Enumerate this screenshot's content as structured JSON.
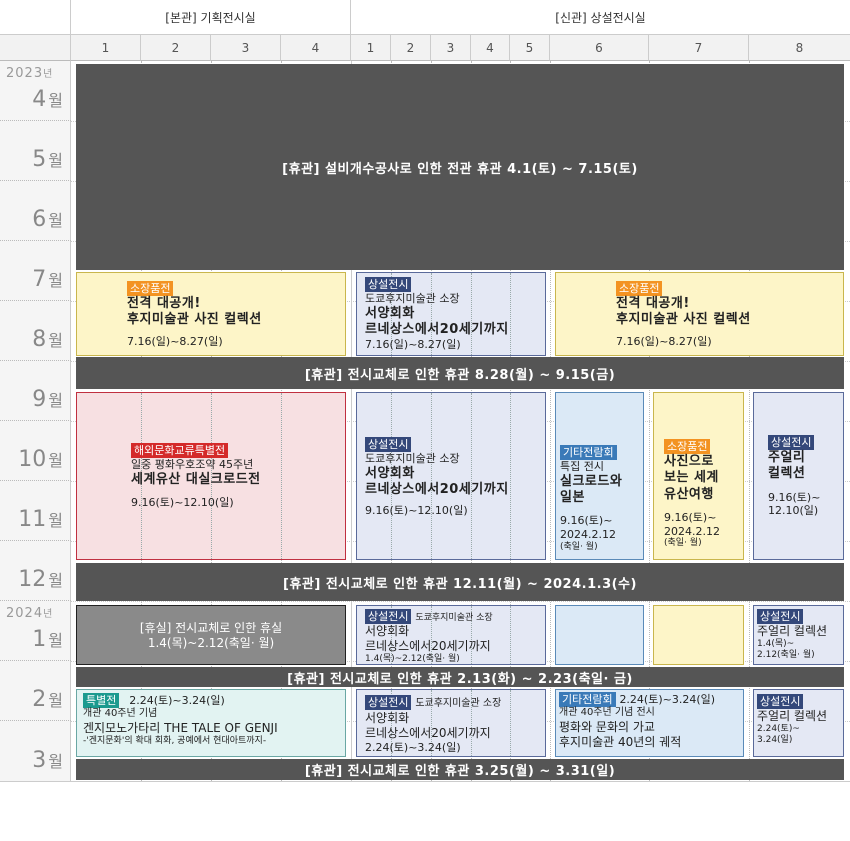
{
  "header": {
    "main_hall": "[본관] 기획전시실",
    "new_hall": "[신관] 상설전시실",
    "cols": [
      "1",
      "2",
      "3",
      "4",
      "1",
      "2",
      "3",
      "4",
      "5",
      "6",
      "7",
      "8"
    ]
  },
  "months": [
    {
      "num": "4",
      "unit": "월",
      "year": "2023",
      "year_unit": "년"
    },
    {
      "num": "5",
      "unit": "월"
    },
    {
      "num": "6",
      "unit": "월"
    },
    {
      "num": "7",
      "unit": "월"
    },
    {
      "num": "8",
      "unit": "월"
    },
    {
      "num": "9",
      "unit": "월"
    },
    {
      "num": "10",
      "unit": "월"
    },
    {
      "num": "11",
      "unit": "월"
    },
    {
      "num": "12",
      "unit": "월"
    },
    {
      "num": "1",
      "unit": "월",
      "year": "2024",
      "year_unit": "년"
    },
    {
      "num": "2",
      "unit": "월"
    },
    {
      "num": "3",
      "unit": "월"
    }
  ],
  "closures": {
    "c1": "[휴관] 설비개수공사로 인한 전관 휴관 4.1(토) ~ 7.15(토)",
    "c2": "[휴관] 전시교체로 인한 휴관 8.28(월) ~ 9.15(금)",
    "c3": "[휴관] 전시교체로 인한 휴관 12.11(월) ~ 2024.1.3(수)",
    "c4": "[휴관] 전시교체로 인한 휴관 2.13(화) ~ 2.23(축일· 금)",
    "c5": "[휴관] 전시교체로 인한 휴관 3.25(월) ~ 3.31(일)"
  },
  "ex": {
    "a1": {
      "tag": "소장품전",
      "title1": "전격 대공개!",
      "title2": "후지미술관 사진 컬렉션",
      "date": "7.16(일)~8.27(일)"
    },
    "a2": {
      "tag": "상설전시",
      "sub": "도쿄후지미술관 소장",
      "title1": "서양회화",
      "title2": "르네상스에서20세기까지",
      "date": "7.16(일)~8.27(일)"
    },
    "a3": {
      "tag": "소장품전",
      "title1": "전격 대공개!",
      "title2": "후지미술관 사진 컬렉션",
      "date": "7.16(일)~8.27(일)"
    },
    "b1": {
      "tag": "해외문화교류특별전",
      "sub": "일중 평화우호조약 45주년",
      "title": "세계유산 대실크로드전",
      "date": "9.16(토)~12.10(일)"
    },
    "b2": {
      "tag": "상설전시",
      "sub": "도쿄후지미술관 소장",
      "title1": "서양회화",
      "title2": "르네상스에서20세기까지",
      "date": "9.16(토)~12.10(일)"
    },
    "b3": {
      "tag": "기타전람회",
      "sub": "특집 전시",
      "title1": "실크로드와",
      "title2": "일본",
      "date1": "9.16(토)~",
      "date2": "2024.2.12",
      "date3": "(축일· 월)"
    },
    "b4": {
      "tag": "소장품전",
      "title1": "사진으로",
      "title2": "보는 세계",
      "title3": "유산여행",
      "date1": "9.16(토)~",
      "date2": "2024.2.12",
      "date3": "(축일· 월)"
    },
    "b5": {
      "tag": "상설전시",
      "title1": "주얼리",
      "title2": "컬렉션",
      "date1": "9.16(토)~",
      "date2": "12.10(일)"
    },
    "c_1": {
      "line1": "[휴실] 전시교체로 인한 휴실",
      "line2": "1.4(목)~2.12(축일· 월)"
    },
    "c_2": {
      "tag": "상설전시",
      "sub": "도쿄후지미술관 소장",
      "title1": "서양회화",
      "title2": "르네상스에서20세기까지",
      "date": "1.4(목)~2.12(축일· 월)"
    },
    "c_5": {
      "tag": "상설전시",
      "title": "주얼리 컬렉션",
      "date1": "1.4(목)~",
      "date2": "2.12(축일· 월)"
    },
    "d1": {
      "tag": "특별전",
      "date": "2.24(토)~3.24(일)",
      "sub": "개관 40주년 기념",
      "title": "겐지모노가타리  THE TALE OF GENJI",
      "desc": "-'겐지문화'의 확대 회화, 공예에서 현대아트까지-"
    },
    "d2": {
      "tag": "상설전시",
      "sub": "도쿄후지미술관 소장",
      "title1": "서양회화",
      "title2": "르네상스에서20세기까지",
      "date": "2.24(토)~3.24(일)"
    },
    "d3": {
      "tag": "기타전람회",
      "date": "2.24(토)~3.24(일)",
      "sub": "개관 40주년 기념 전시",
      "title1": "평화와 문화의 가교",
      "title2": "후지미술관 40년의 궤적"
    },
    "d4": {
      "tag": "상설전시",
      "title": "주얼리 컬렉션",
      "date1": "2.24(토)~",
      "date2": "3.24(일)"
    }
  }
}
